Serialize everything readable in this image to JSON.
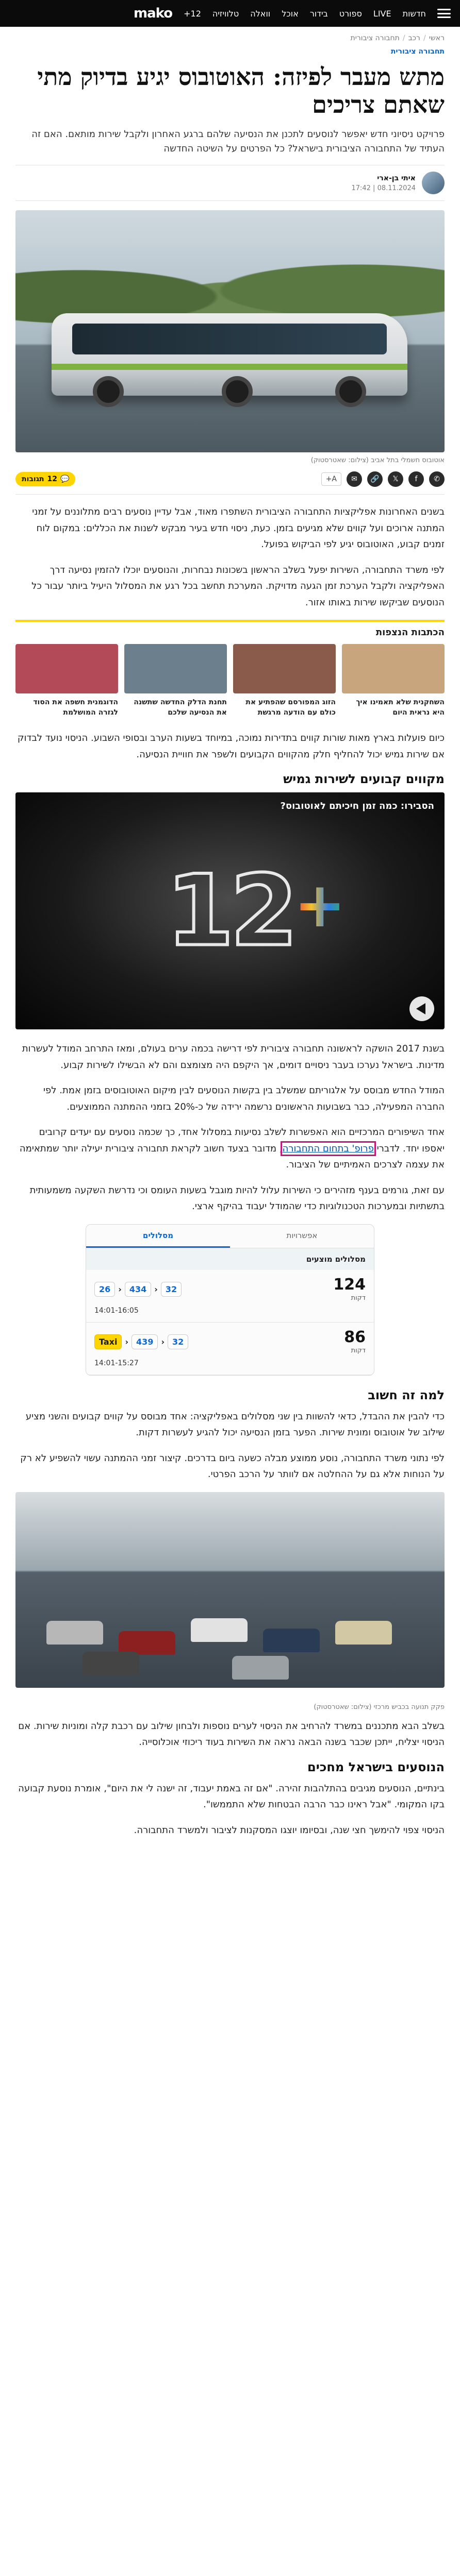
{
  "header": {
    "logo": "mako",
    "nav": [
      "חדשות",
      "LIVE",
      "ספורט",
      "בידור",
      "אוכל",
      "וואלה",
      "טלוויזיה",
      "12+"
    ],
    "menu_icon": "hamburger-icon"
  },
  "breadcrumb": [
    "ראשי",
    "רכב",
    "תחבורה ציבורית"
  ],
  "tag": "תחבורה ציבורית",
  "article": {
    "title": "מתש מעבר לפיזה: האוטובוס יגיע בדיוק מתי שאתם צריכים",
    "subtitle": "פרויקט ניסיוני חדש יאפשר לנוסעים לתכנן את הנסיעה שלהם ברגע האחרון ולקבל שירות מותאם. האם זה העתיד של התחבורה הציבורית בישראל? כל הפרטים על השיטה החדשה",
    "author": "איתי בן-ארי",
    "date": "08.11.2024 | 17:42",
    "hero_caption": "אוטובוס חשמלי בתל אביב (צילום: שאטרסטוק)",
    "comments_label": "תגובות",
    "comments_count": "12",
    "font_label": "A+"
  },
  "paragraphs": {
    "p1": "בשנים האחרונות אפליקציות התחבורה הציבורית השתפרו מאוד, אבל עדיין נוסעים רבים מתלוננים על זמני המתנה ארוכים ועל קווים שלא מגיעים בזמן. כעת, ניסוי חדש בעיר מבקש לשנות את הכללים: במקום לוח זמנים קבוע, האוטובוס יגיע לפי הביקוש בפועל.",
    "p2": "לפי משרד התחבורה, השירות יפעל בשלב הראשון בשכונות נבחרות, והנוסעים יוכלו להזמין נסיעה דרך האפליקציה ולקבל הערכת זמן הגעה מדויקת. המערכת תחשב בכל רגע את המסלול היעיל ביותר עבור כל הנוסעים שביקשו שירות באותו אזור.",
    "p3": "כיום פועלות בארץ מאות שורות קווים בתדירות נמוכה, במיוחד בשעות הערב ובסופי השבוע. הניסוי נועד לבדוק אם שירות גמיש יכול להחליף חלק מהקווים הקבועים ולשפר את חוויית הנסיעה.",
    "section1": "מקווים קבועים לשירות גמיש",
    "p4": "בשנת 2017 הושקה לראשונה תחבורה ציבורית לפי דרישה בכמה ערים בעולם, ומאז התרחב המודל לעשרות מדינות. בישראל נערכו בעבר ניסויים דומים, אך היקפם היה מצומצם והם לא הבשילו לשירות קבוע.",
    "p5": "המודל החדש מבוסס על אלגוריתם שמשלב בין בקשות הנוסעים לבין מיקום האוטובוסים בזמן אמת. לפי החברה המפעילה, כבר בשבועות הראשונים נרשמה ירידה של כ-20% בזמני ההמתנה הממוצעים.",
    "p6_before": "אחד השיפורים המרכזיים הוא האפשרות לשלב נסיעות במסלול אחד, כך שכמה נוסעים עם יעדים קרובים יאספו יחד. לדברי ",
    "p6_link": "פרופ' בתחום התחבורה",
    "p6_after": ", מדובר בצעד חשוב לקראת תחבורה ציבורית יעילה יותר שמתאימה את עצמה לצרכים האמיתיים של הציבור.",
    "p7": "עם זאת, גורמים בענף מזהירים כי השירות עלול להיות מוגבל בשעות העומס וכי נדרשת השקעה משמעותית בתשתיות ובמערכות הטכנולוגיות כדי שהמודל יעבוד בהיקף ארצי.",
    "section2": "למה זה חשוב",
    "p8": "כדי להבין את ההבדל, כדאי להשוות בין שני מסלולים באפליקציה: אחד מבוסס על קווים קבועים והשני מציע שילוב של אוטובוס ומונית שירות. הפער בזמן הנסיעה יכול להגיע לעשרות דקות.",
    "p9": "לפי נתוני משרד התחבורה, נוסע ממוצע מבלה כשעה ביום בדרכים. קיצור זמני ההמתנה עשוי להשפיע לא רק על הנוחות אלא גם על ההחלטה אם לוותר על הרכב הפרטי.",
    "p10": "בשלב הבא מתכננים במשרד להרחיב את הניסוי לערים נוספות ולבחון שילוב עם רכבת קלה ומוניות שירות. אם הניסוי יצליח, ייתכן שכבר בשנה הבאה נראה את השירות בעוד ריכוזי אוכלוסייה.",
    "section3": "הנוסעים בישראל מחכים",
    "p11": "בינתיים, הנוסעים מגיבים בהתלהבות זהירה. \"אם זה באמת יעבוד, זה ישנה לי את היום\", אומרת נוסעת קבועה בקו המקומי. \"אבל ראינו כבר הרבה הבטחות שלא התממשו\".",
    "p12": "הניסוי צפוי להימשך חצי שנה, ובסיומו יוצגו המסקנות לציבור ולמשרד התחבורה."
  },
  "related": {
    "heading": "הכתבות הנצפות",
    "items": [
      "השחקנית שלא תאמינו איך היא נראית היום",
      "הזוג המפורסם שהפתיע את כולם עם הודעה מרגשת",
      "תחנת הדלק החדשה שתשנה את הנסיעה שלכם",
      "הדוגמנית חשפה את הסוד לגזרה המושלמת"
    ],
    "thumb_colors": [
      "#c9a57d",
      "#8a5b4a",
      "#6c7f8d",
      "#b34a57"
    ]
  },
  "video": {
    "title": "הסבירו: כמה זמן חיכיתם לאוטובוס?",
    "logo_text": "12",
    "logo_plus": "+"
  },
  "app_card": {
    "tabs": [
      "מסלולים",
      "אפשרויות"
    ],
    "section": "מסלולים מוצעים",
    "trips": [
      {
        "duration": "124",
        "unit": "דקות",
        "legs": [
          "26",
          "434",
          "32"
        ],
        "time": "14:01-16:05"
      },
      {
        "duration": "86",
        "unit": "דקות",
        "legs": [
          "Taxi",
          "439",
          "32"
        ],
        "time": "14:01-15:27"
      }
    ]
  },
  "street_caption": "פקק תנועה בכביש מרכזי (צילום: שאטרסטוק)",
  "colors": {
    "accent": "#ffd500",
    "link": "#0055b3",
    "highlight": "#c2187a",
    "topbar": "#0b0b0b"
  }
}
